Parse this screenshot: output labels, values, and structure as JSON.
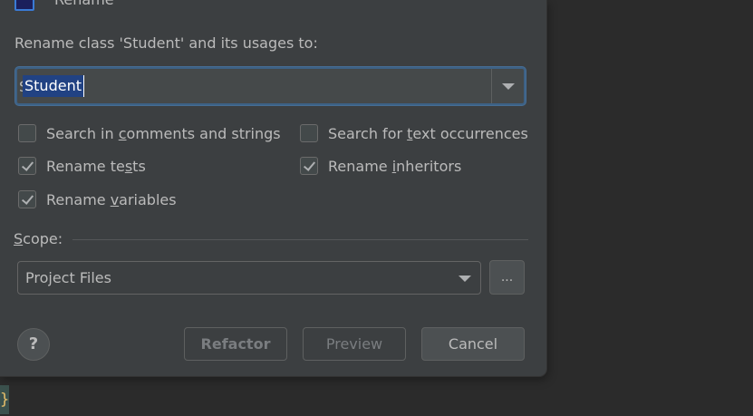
{
  "window": {
    "title": "Rename",
    "icon": "intellij-app-icon",
    "close_icon": "close-icon"
  },
  "prompt": "Rename class 'Student' and its usages to:",
  "name_field": {
    "value": "Student",
    "selected": true
  },
  "options": {
    "search_comments": {
      "label_pre": "Search in ",
      "label_mnemonic": "c",
      "label_post": "omments and strings",
      "checked": false
    },
    "search_text": {
      "label_pre": "Search for ",
      "label_mnemonic": "t",
      "label_post": "ext occurrences",
      "checked": false
    },
    "rename_tests": {
      "label_pre": "Rename te",
      "label_mnemonic": "s",
      "label_post": "ts",
      "checked": true
    },
    "rename_inheritors": {
      "label_pre": "Rename ",
      "label_mnemonic": "i",
      "label_post": "nheritors",
      "checked": true
    },
    "rename_variables": {
      "label_pre": "Rename ",
      "label_mnemonic": "v",
      "label_post": "ariables",
      "checked": true
    }
  },
  "scope": {
    "label_mnemonic": "S",
    "label_post": "cope:",
    "value": "Project Files",
    "browse_label": "..."
  },
  "buttons": {
    "help": "?",
    "refactor": "Refactor",
    "preview": "Preview",
    "cancel": "Cancel"
  },
  "editor": {
    "visible_text": "}"
  },
  "colors": {
    "dialog_bg": "#3c3f41",
    "editor_bg": "#2b2b2b",
    "text": "#bbbbbb",
    "selection": "#214283",
    "focus_border": "#3d6185"
  }
}
